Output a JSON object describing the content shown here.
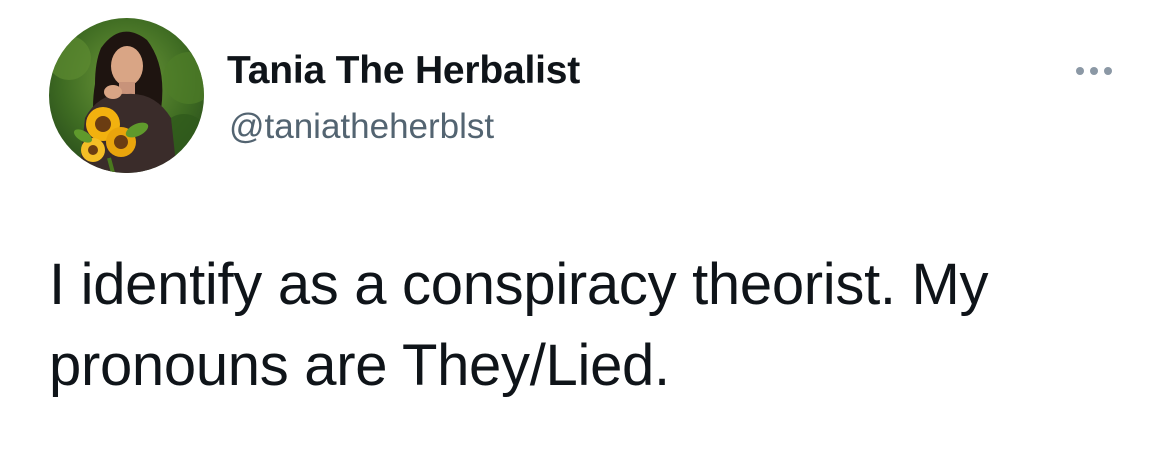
{
  "author": {
    "display_name": "Tania The Herbalist",
    "handle": "@taniatheherblst"
  },
  "tweet": {
    "text": "I identify as a conspiracy theorist. My pronouns are They/Lied."
  },
  "icons": {
    "more": "more-horizontal-icon",
    "avatar": "profile-photo"
  },
  "colors": {
    "text_primary": "#0f1419",
    "text_secondary": "#536471",
    "icon_muted": "#8b98a5",
    "background": "#ffffff"
  }
}
